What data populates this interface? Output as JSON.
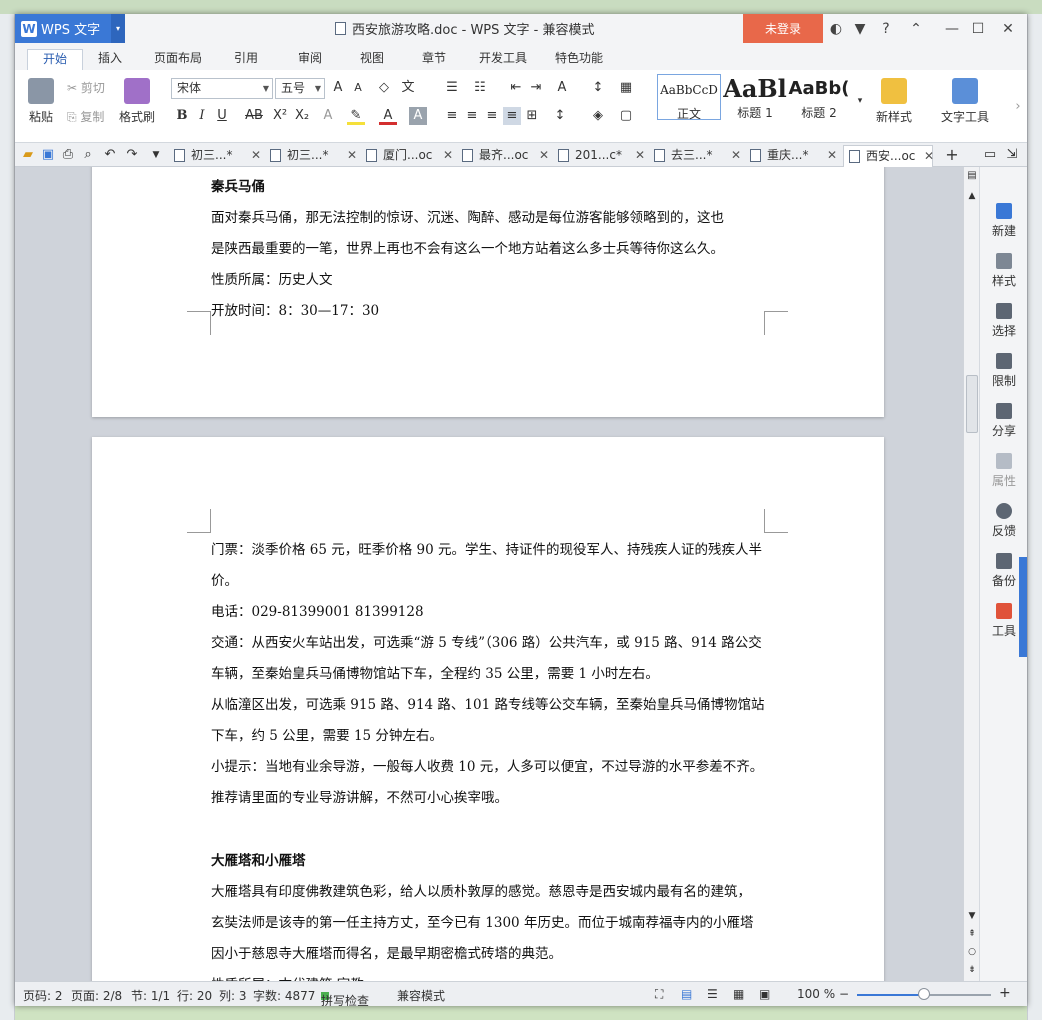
{
  "app": {
    "logo": "WPS 文字",
    "title": "西安旅游攻略.doc - WPS 文字 - 兼容模式",
    "login": "未登录"
  },
  "ribbon_tabs": [
    "开始",
    "插入",
    "页面布局",
    "引用",
    "审阅",
    "视图",
    "章节",
    "开发工具",
    "特色功能"
  ],
  "ribbon": {
    "paste": "粘贴",
    "cut": "剪切",
    "copy": "复制",
    "format_painter": "格式刷",
    "font_name": "宋体",
    "font_size": "五号",
    "styles": [
      {
        "preview": "AaBbCcD",
        "label": "正文"
      },
      {
        "preview": "AaBl",
        "label": "标题 1"
      },
      {
        "preview": "AaBb(",
        "label": "标题 2"
      }
    ],
    "new_style": "新样式",
    "text_tools": "文字工具"
  },
  "doc_tabs": [
    "初三...",
    "初三...",
    "厦门...oc",
    "最齐...oc",
    "201...c",
    "去三...",
    "重庆...",
    "西安...oc"
  ],
  "page1": {
    "heading": "秦兵马俑",
    "lines": [
      "面对秦兵马俑，那无法控制的惊讶、沉迷、陶醉、感动是每位游客能够领略到的，这也",
      "是陕西最重要的一笔，世界上再也不会有这么一个地方站着这么多士兵等待你这么久。",
      "性质所属：历史人文",
      "开放时间：8：30—17：30"
    ]
  },
  "page2": {
    "lines": [
      "门票：淡季价格 65 元，旺季价格 90 元。学生、持证件的现役军人、持残疾人证的残疾人半",
      "价。",
      "电话：029-81399001 81399128",
      "交通：从西安火车站出发，可选乘“游 5 专线”（306 路）公共汽车，或 915 路、914 路公交",
      "车辆，至秦始皇兵马俑博物馆站下车，全程约 35 公里，需要 1 小时左右。",
      "从临潼区出发，可选乘 915 路、914 路、101 路专线等公交车辆，至秦始皇兵马俑博物馆站",
      "下车，约 5 公里，需要 15 分钟左右。",
      "小提示：当地有业余导游，一般每人收费 10 元，人多可以便宜，不过导游的水平参差不齐。",
      "推荐请里面的专业导游讲解，不然可小心挨宰哦。"
    ],
    "heading2": "大雁塔和小雁塔",
    "lines2": [
      "大雁塔具有印度佛教建筑色彩，给人以质朴敦厚的感觉。慈恩寺是西安城内最有名的建筑，",
      "玄奘法师是该寺的第一任主持方丈，至今已有 1300 年历史。而位于城南荐福寺内的小雁塔",
      "因小于慈恩寺大雁塔而得名，是最早期密檐式砖塔的典范。",
      "性质所属：古代建筑 宗教"
    ]
  },
  "side_panel": [
    "新建",
    "样式",
    "选择",
    "限制",
    "分享",
    "属性",
    "反馈",
    "备份",
    "工具"
  ],
  "status": {
    "page_code": "页码: 2",
    "pages": "页面: 2/8",
    "section": "节: 1/1",
    "row": "行: 20",
    "col": "列: 3",
    "words": "字数: 4877",
    "spell": "拼写检查",
    "mode": "兼容模式",
    "zoom": "100 %",
    "zoom_fraction": 0.5
  },
  "colors": {
    "accent": "#3a78d6",
    "login": "#e8684a"
  }
}
